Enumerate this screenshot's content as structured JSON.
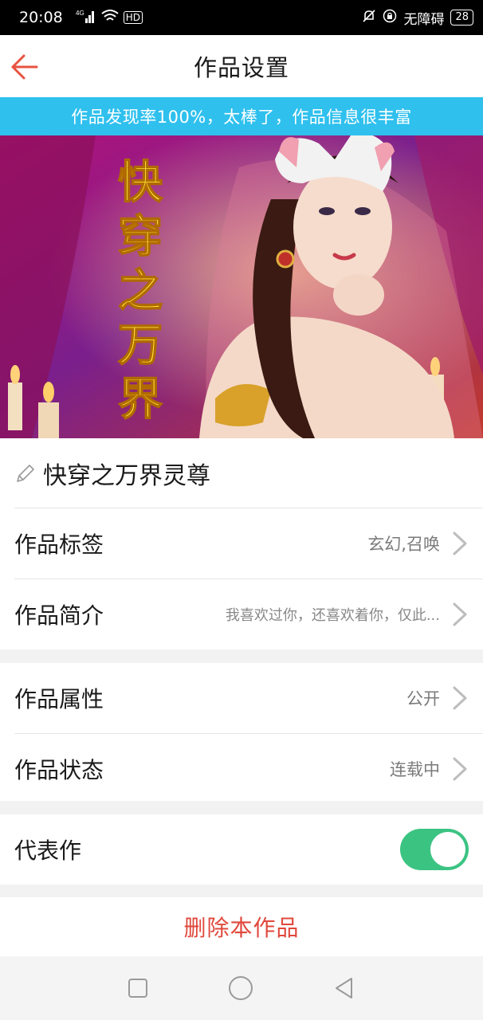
{
  "status_bar": {
    "time": "20:08",
    "network": "4G",
    "wifi_label": "HD",
    "accessibility": "无障碍",
    "battery": "28"
  },
  "app_bar": {
    "title": "作品设置",
    "back_icon": "arrow-left-icon",
    "accent_color": "#e8533f"
  },
  "banner": {
    "text": "作品发现率100%，太棒了，作品信息很丰富",
    "color": "#2fc0ee"
  },
  "cover": {
    "title_art": [
      "快",
      "穿",
      "之",
      "万",
      "界"
    ]
  },
  "work": {
    "name": "快穿之万界灵尊",
    "edit_icon": "pencil-icon"
  },
  "rows": {
    "tags": {
      "label": "作品标签",
      "value": "玄幻,召唤"
    },
    "intro": {
      "label": "作品简介",
      "value": "我喜欢过你，还喜欢着你，仅此..."
    },
    "attribute": {
      "label": "作品属性",
      "value": "公开"
    },
    "status": {
      "label": "作品状态",
      "value": "连载中"
    },
    "masterpiece": {
      "label": "代表作",
      "toggle_on": true,
      "toggle_color": "#3bc382"
    }
  },
  "delete": {
    "label": "删除本作品",
    "color": "#e0483c"
  },
  "nav_bar": {
    "buttons": [
      "square-recent-icon",
      "circle-home-icon",
      "triangle-back-icon"
    ]
  }
}
